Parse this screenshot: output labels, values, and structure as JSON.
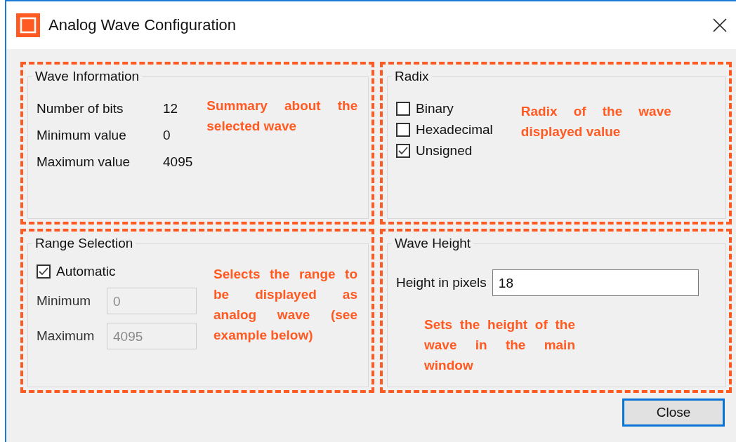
{
  "window": {
    "title": "Analog Wave Configuration"
  },
  "wave_information": {
    "title": "Wave Information",
    "rows": [
      {
        "label": "Number of bits",
        "value": "12"
      },
      {
        "label": "Minimum value",
        "value": "0"
      },
      {
        "label": "Maximum value",
        "value": "4095"
      }
    ],
    "annotation": "Summary about the selected wave"
  },
  "radix": {
    "title": "Radix",
    "options": [
      {
        "label": "Binary",
        "checked": false
      },
      {
        "label": "Hexadecimal",
        "checked": false
      },
      {
        "label": "Unsigned",
        "checked": true
      }
    ],
    "annotation": "Radix of the wave displayed value"
  },
  "range_selection": {
    "title": "Range Selection",
    "automatic": {
      "label": "Automatic",
      "checked": true
    },
    "fields": [
      {
        "label": "Minimum",
        "value": "0",
        "disabled": true
      },
      {
        "label": "Maximum",
        "value": "4095",
        "disabled": true
      }
    ],
    "annotation": "Selects the range to be displayed as analog wave (see example below)"
  },
  "wave_height": {
    "title": "Wave Height",
    "field": {
      "label": "Height in pixels",
      "value": "18",
      "disabled": false
    },
    "annotation": "Sets the height of the wave in the main window"
  },
  "buttons": [
    {
      "label": "Close",
      "default": true
    }
  ]
}
